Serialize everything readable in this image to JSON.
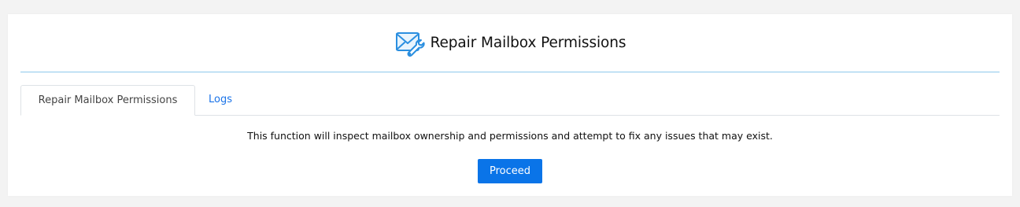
{
  "header": {
    "title": "Repair Mailbox Permissions",
    "icon": "mail-wrench-icon"
  },
  "tabs": [
    {
      "label": "Repair Mailbox Permissions",
      "active": true
    },
    {
      "label": "Logs",
      "active": false
    }
  ],
  "main": {
    "description": "This function will inspect mailbox ownership and permissions and attempt to fix any issues that may exist.",
    "proceed_label": "Proceed"
  },
  "colors": {
    "accent": "#0a74e8",
    "icon": "#2b8fe0",
    "rule": "#8ec9ec"
  }
}
